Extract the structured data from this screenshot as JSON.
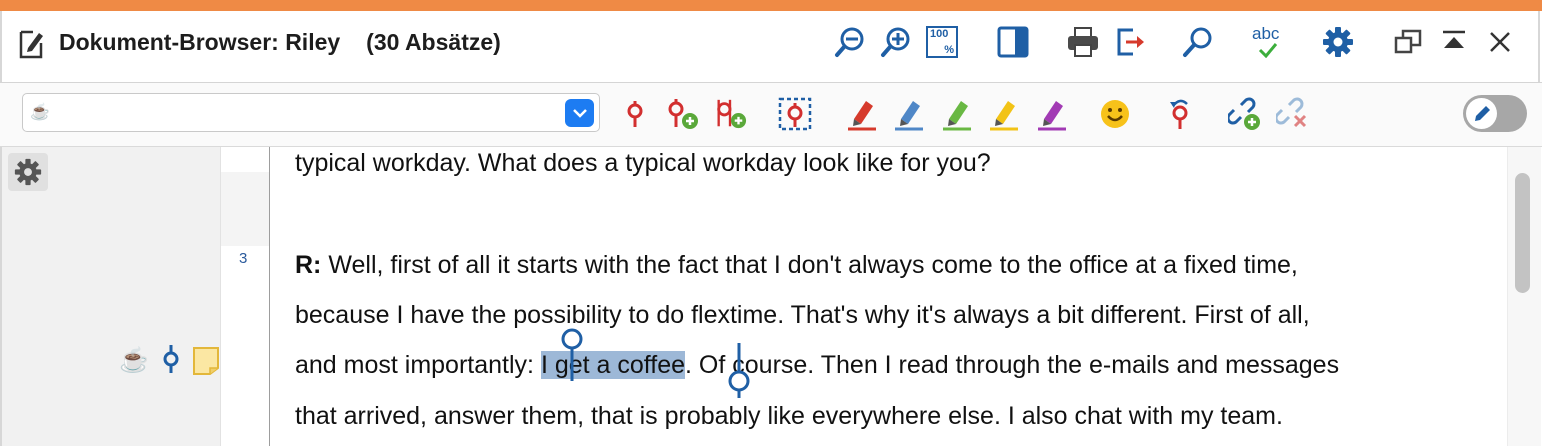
{
  "window": {
    "title": "Dokument-Browser: Riley",
    "subtitle": "(30 Absätze)",
    "accent_color": "#ef8a45",
    "icon_color": "#1f5fa5"
  },
  "toolbar_top": {
    "icons": [
      "zoom-out-icon",
      "zoom-in-icon",
      "zoom-100-icon",
      "panel-toggle-icon",
      "print-icon",
      "export-icon",
      "search-icon",
      "spellcheck-icon",
      "settings-gear-icon",
      "detach-window-icon",
      "collapse-icon",
      "close-icon"
    ],
    "zoom_100_label": "100",
    "zoom_100_sub": "%",
    "spellcheck_label": "abc"
  },
  "toolbar_codes": {
    "code_selector_value": "☕",
    "icons": [
      "code-pin-icon",
      "code-pin-add-icon",
      "code-pin-add-multi-icon",
      "code-selection-icon",
      "highlighter-red-icon",
      "highlighter-blue-icon",
      "highlighter-green-icon",
      "highlighter-yellow-icon",
      "highlighter-purple-icon",
      "emoticon-icon",
      "undo-code-icon",
      "link-add-icon",
      "link-remove-icon"
    ],
    "edit_toggle": "off"
  },
  "document": {
    "paragraph_number": "3",
    "lines": [
      {
        "text": "typical workday. What does a typical workday look like for you?"
      },
      {
        "speaker": "R:",
        "text": " Well, first of all it starts with the fact that I don't always come to the office at a fixed time,"
      },
      {
        "text": "because I have the possibility to do flextime. That's why it's always a bit different. First of all,"
      },
      {
        "before": "and most importantly: ",
        "highlight": "I get a coffee",
        "after": ". Of course. Then I read through the e-mails and messages"
      },
      {
        "text": "that arrived, answer them, that is probably like everywhere else. I also chat with my team."
      }
    ],
    "segment": {
      "code_emoji": "☕",
      "highlight_color": "#9db8d7"
    }
  }
}
